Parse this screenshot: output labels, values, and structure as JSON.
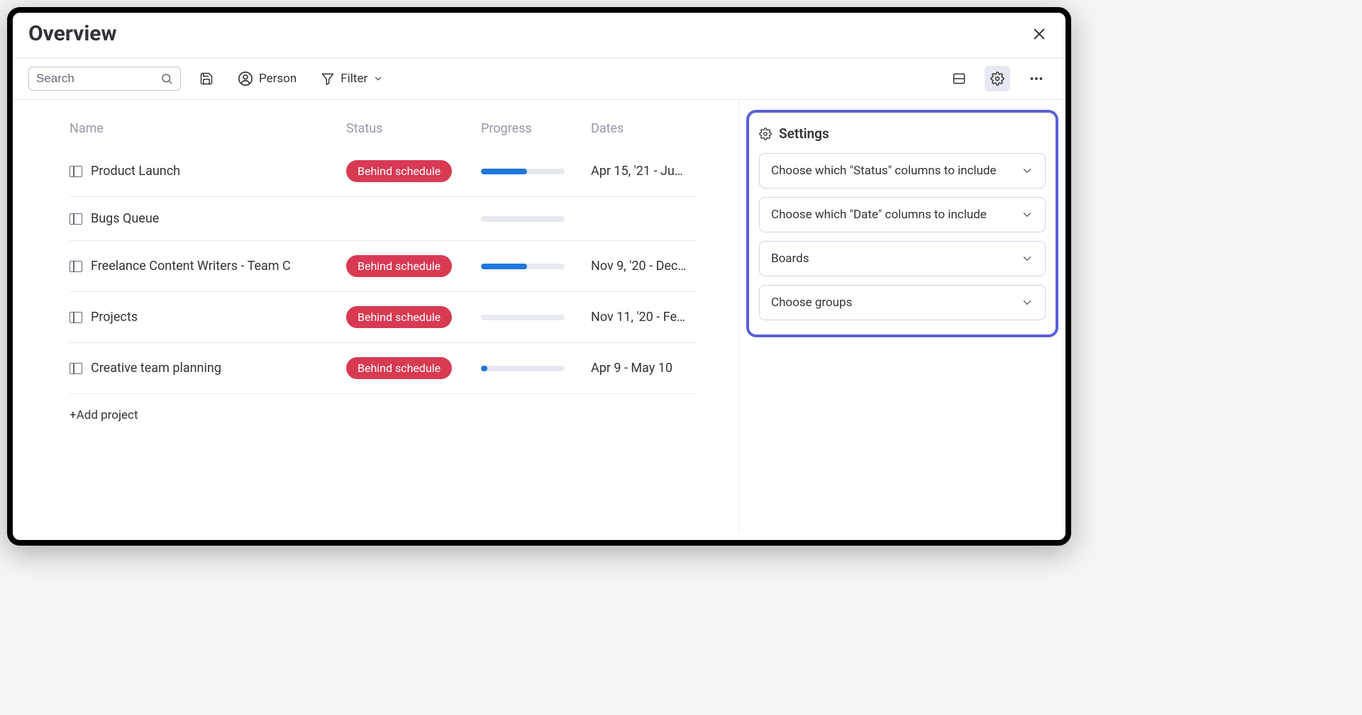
{
  "window": {
    "title": "Overview"
  },
  "toolbar": {
    "search_placeholder": "Search",
    "person_label": "Person",
    "filter_label": "Filter"
  },
  "columns": {
    "name": "Name",
    "status": "Status",
    "progress": "Progress",
    "dates": "Dates"
  },
  "rows": [
    {
      "name": "Product Launch",
      "status": "Behind schedule",
      "progress": 55,
      "dates": "Apr 15, '21 - Ju…"
    },
    {
      "name": "Bugs Queue",
      "status": "",
      "progress": 0,
      "dates": ""
    },
    {
      "name": "Freelance Content Writers - Team C",
      "status": "Behind schedule",
      "progress": 55,
      "dates": "Nov 9, '20 - Dec…"
    },
    {
      "name": "Projects",
      "status": "Behind schedule",
      "progress": 0,
      "dates": "Nov 11, '20 - Fe…"
    },
    {
      "name": "Creative team planning",
      "status": "Behind schedule",
      "progress": 8,
      "dates": "Apr 9 - May 10"
    }
  ],
  "add_project_label": "+Add project",
  "settings": {
    "title": "Settings",
    "items": [
      "Choose which \"Status\" columns to include",
      "Choose which \"Date\" columns to include",
      "Boards",
      "Choose groups"
    ]
  }
}
